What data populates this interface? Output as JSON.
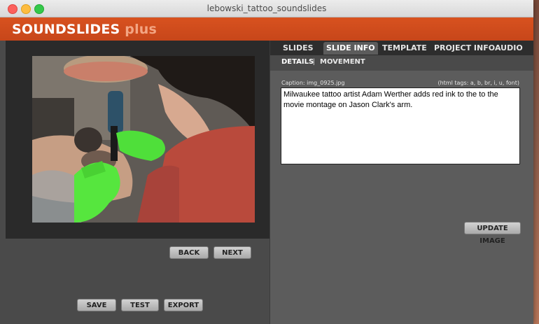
{
  "window": {
    "title": "lebowski_tattoo_soundslides"
  },
  "app": {
    "brand": "SOUNDSLIDES",
    "brand_suffix": "plus"
  },
  "tabs": [
    {
      "label": "SLIDES",
      "active": false
    },
    {
      "label": "SLIDE INFO",
      "active": true
    },
    {
      "label": "TEMPLATE",
      "active": false
    },
    {
      "label": "PROJECT INFO",
      "active": false
    },
    {
      "label": "AUDIO",
      "active": false
    }
  ],
  "subtabs": {
    "details": "DETAILS",
    "separator": "|",
    "movement": "MOVEMENT"
  },
  "caption": {
    "label": "Caption: img_0925.jpg",
    "tags_hint": "(html tags: a, b, br, i, u, font)",
    "text": "Milwaukee tattoo artist Adam Werther adds red ink to the to the movie montage on Jason Clark's arm."
  },
  "buttons": {
    "update_image": "UPDATE IMAGE",
    "back": "BACK",
    "next": "NEXT",
    "save": "SAVE",
    "test": "TEST",
    "export": "EXPORT"
  },
  "colors": {
    "brand_orange": "#cf4b1c",
    "panel_dark": "#2a2a2a",
    "panel_mid": "#4a4a4a",
    "panel_right": "#5c5c5c"
  }
}
